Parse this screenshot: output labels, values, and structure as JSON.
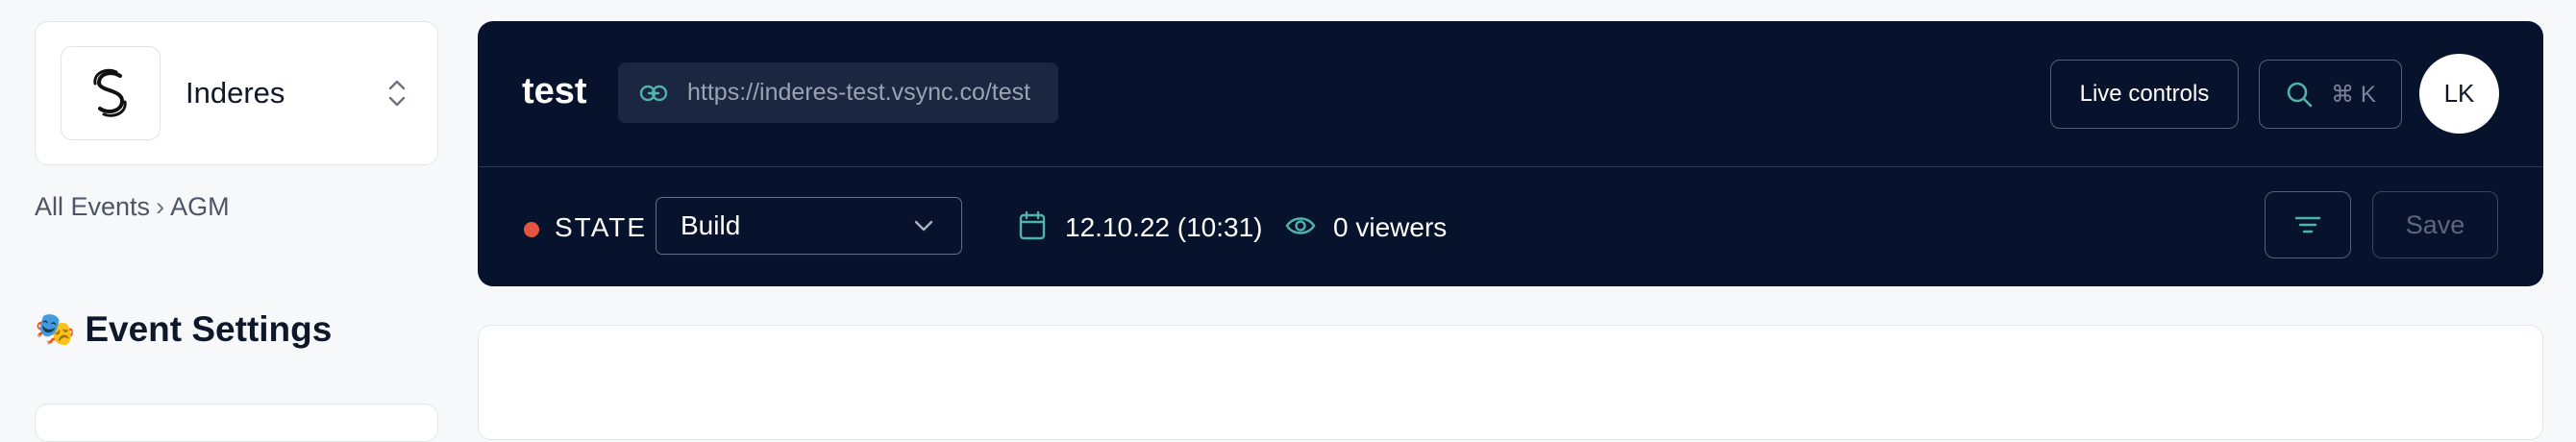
{
  "sidebar": {
    "org_name": "Inderes",
    "breadcrumb": {
      "root": "All Events",
      "separator": "›",
      "current": "AGM"
    },
    "section_title": "Event Settings",
    "section_emoji": "🎭"
  },
  "header": {
    "event_name": "test",
    "url": "https://inderes-test.vsync.co/test",
    "live_controls_label": "Live controls",
    "search_shortcut": "⌘ K",
    "avatar_initials": "LK",
    "state_label": "STATE",
    "state_value": "Build",
    "date": "12.10.22 (10:31)",
    "viewers": "0 viewers",
    "save_label": "Save"
  },
  "colors": {
    "header_bg": "#07132d",
    "state_dot": "#e4543e",
    "accent_icon": "#4fb3a9"
  }
}
